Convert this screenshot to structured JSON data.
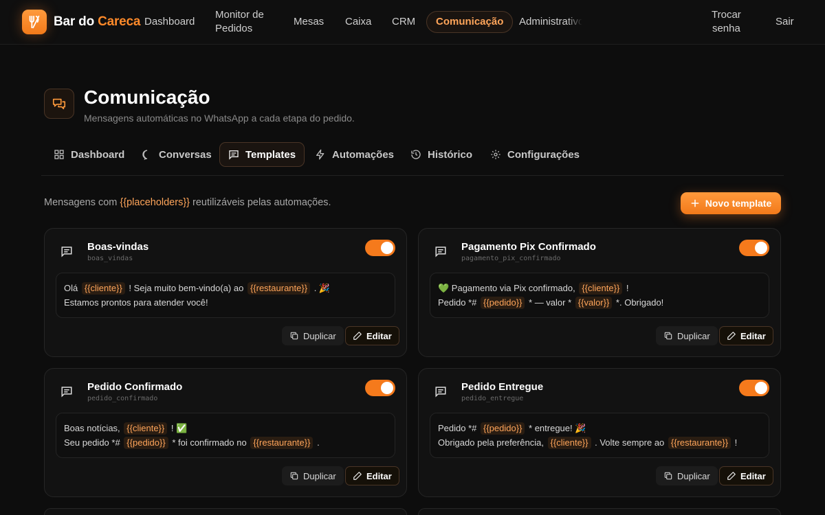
{
  "brand": {
    "part1": "Bar do ",
    "part2": "Careca",
    "accent": "#ff8a2a"
  },
  "nav": {
    "dashboard": "Dashboard",
    "monitor_line1": "Monitor de",
    "monitor_line2": "Pedidos",
    "mesas": "Mesas",
    "caixa": "Caixa",
    "crm": "CRM",
    "comunicacao": "Comunicação",
    "administrativo": "Administrativo",
    "trocar_line1": "Trocar",
    "trocar_line2": "senha",
    "sair": "Sair"
  },
  "page": {
    "title": "Comunicação",
    "subtitle": "Mensagens automáticas no WhatsApp a cada etapa do pedido."
  },
  "tabs": [
    {
      "label": "Dashboard",
      "icon": "grid-icon"
    },
    {
      "label": "Conversas",
      "icon": "chat-bubble-icon"
    },
    {
      "label": "Templates",
      "icon": "message-square-icon"
    },
    {
      "label": "Automações",
      "icon": "lightning-icon"
    },
    {
      "label": "Histórico",
      "icon": "history-icon"
    },
    {
      "label": "Configurações",
      "icon": "gear-icon"
    }
  ],
  "intro": {
    "prefix": "Mensagens com ",
    "placeholder": "{{placeholders}}",
    "suffix": " reutilizáveis pelas automações."
  },
  "new_template_label": "Novo template",
  "buttons": {
    "duplicate": "Duplicar",
    "edit": "Editar"
  },
  "templates": [
    {
      "title": "Boas-vindas",
      "slug": "boas_vindas",
      "enabled": true,
      "l1a": "Olá ",
      "l1t1": "{{cliente}}",
      "l1b": " ! Seja muito bem-vindo(a) ao ",
      "l1t2": "{{restaurante}}",
      "l1c": " . 🎉",
      "l2": "Estamos prontos para atender você!"
    },
    {
      "title": "Pagamento Pix Confirmado",
      "slug": "pagamento_pix_confirmado",
      "enabled": true,
      "l1a": "💚 Pagamento via Pix confirmado, ",
      "l1t1": "{{cliente}}",
      "l1b": " !",
      "l2a": "Pedido *# ",
      "l2t1": "{{pedido}}",
      "l2b": " * — valor * ",
      "l2t2": "{{valor}}",
      "l2c": " *. Obrigado!"
    },
    {
      "title": "Pedido Confirmado",
      "slug": "pedido_confirmado",
      "enabled": true,
      "l1a": "Boas notícias, ",
      "l1t1": "{{cliente}}",
      "l1b": " ! ✅",
      "l2a": "Seu pedido *# ",
      "l2t1": "{{pedido}}",
      "l2b": " * foi confirmado no ",
      "l2t2": "{{restaurante}}",
      "l2c": " ."
    },
    {
      "title": "Pedido Entregue",
      "slug": "pedido_entregue",
      "enabled": true,
      "l1a": "Pedido *# ",
      "l1t1": "{{pedido}}",
      "l1b": " * entregue! 🎉",
      "l2a": "Obrigado pela preferência, ",
      "l2t1": "{{cliente}}",
      "l2b": " . Volte sempre ao ",
      "l2t2": "{{restaurante}}",
      "l2c": " !"
    }
  ]
}
